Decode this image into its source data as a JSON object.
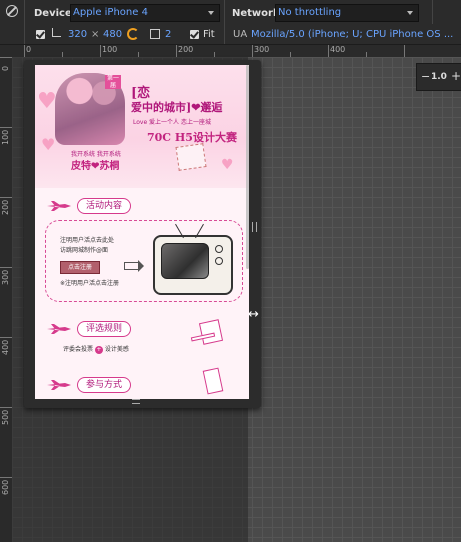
{
  "toolbar": {
    "device_label": "Device",
    "device_value": "Apple iPhone 4",
    "network_label": "Network",
    "network_value": "No throttling",
    "width_value": "320",
    "times_sign": "×",
    "height_value": "480",
    "scale_value": "2",
    "fit_label": "Fit",
    "ua_label": "UA",
    "ua_value": "Mozilla/5.0 (iPhone; U; CPU iPhone OS ..."
  },
  "zoom": {
    "minus": "−",
    "value": "1.0",
    "plus": "+"
  },
  "ruler": {
    "h_labels": [
      "0",
      "100",
      "200",
      "300",
      "400"
    ],
    "v_labels": [
      "0",
      "100",
      "200",
      "300",
      "400",
      "500",
      "600"
    ]
  },
  "page": {
    "hero_badge": "第一届",
    "hero_title_line1": "[恋",
    "hero_title_line2": "爱中的城市]❤邂逅",
    "hero_subtitle": "Love 爱上一个人 恋上一座城",
    "hero_contest": "70C H5设计大赛",
    "names_small": "我开系统    我开系统",
    "names": "皮特❤苏桐",
    "section1": "活动内容",
    "content_line1": "注明用户活点去此处",
    "content_line2": "访跳网城制作@面",
    "content_button": "点击注册",
    "content_line3": "※注明用户活点击注册",
    "section2": "评选规则",
    "rules_prefix": "评委会投票",
    "rules_dot": "+",
    "rules_suffix": "设计美感",
    "section3": "参与方式"
  }
}
